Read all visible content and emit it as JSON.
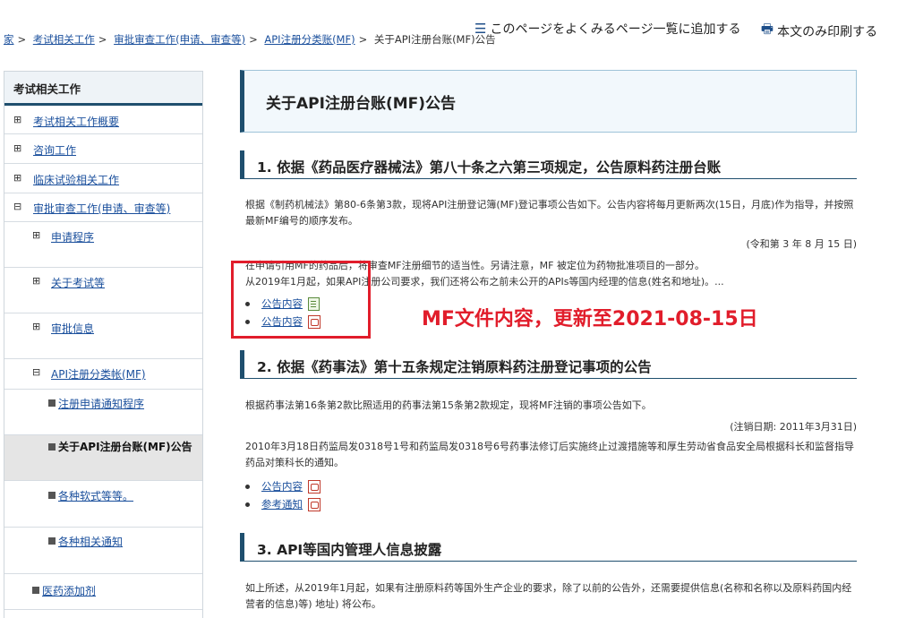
{
  "utility": {
    "favorites_label": "このページをよくみるページ一覧に追加する",
    "print_label": "本文のみ印刷する"
  },
  "breadcrumb": [
    {
      "label": "家"
    },
    {
      "label": "考试相关工作"
    },
    {
      "label": "审批审查工作(申请、审查等)"
    },
    {
      "label": "API注册分类账(MF)"
    },
    {
      "label": "关于API注册台账(MF)公告"
    }
  ],
  "sidebar": {
    "title": "考试相关工作",
    "items": [
      {
        "label": "考试相关工作概要",
        "mark": "⊞"
      },
      {
        "label": "咨询工作",
        "mark": "⊞"
      },
      {
        "label": "临床试验相关工作",
        "mark": "⊞"
      },
      {
        "label": "审批审查工作(申请、审查等)",
        "mark": "⊟"
      },
      {
        "label": "申请程序",
        "mark": "⊞"
      },
      {
        "label": "关于考试等",
        "mark": "⊞"
      },
      {
        "label": "审批信息",
        "mark": "⊞"
      },
      {
        "label": "API注册分类帐(MF)",
        "mark": "⊟"
      },
      {
        "label": "注册申请通知程序"
      },
      {
        "label": "关于API注册台账(MF)公告"
      },
      {
        "label": "各种软式等等。"
      },
      {
        "label": "各种相关通知"
      },
      {
        "label": "医药添加剂"
      }
    ]
  },
  "main": {
    "title": "关于API注册台账(MF)公告",
    "section1": {
      "heading": "1. 依据《药品医疗器械法》第八十条之六第三项规定，公告原料药注册台账",
      "para1": "根据《制药机械法》第80-6条第3款，现将API注册登记簿(MF)登记事项公告如下。公告内容将每月更新两次(15日，月底)作为指导，并按照最新MF编号的顺序发布。",
      "date": "(令和第 3 年 8 月 15 日)",
      "para2": "在申请引用MF的药品后，将审查MF注册细节的适当性。另请注意，MF 被定位为药物批准项目的一部分。",
      "para3": "从2019年1月起，如果API注册公司要求，我们还将公布之前未公开的APIs等国内经理的信息(姓名和地址)。...",
      "links": [
        "公告内容",
        "公告内容"
      ]
    },
    "section2": {
      "heading": "2. 依据《药事法》第十五条规定注销原料药注册登记事项的公告",
      "para1": "根据药事法第16条第2款比照适用的药事法第15条第2款规定，现将MF注销的事项公告如下。",
      "date": "(注销日期: 2011年3月31日)",
      "para2": "2010年3月18日药监局发0318号1号和药监局发0318号6号药事法修订后实施终止过渡措施等和厚生劳动省食品安全局根据科长和监督指导药品对策科长的通知。",
      "links": [
        "公告内容",
        "参考通知"
      ]
    },
    "section3": {
      "heading": "3. API等国内管理人信息披露",
      "para1": "如上所述，从2019年1月起，如果有注册原料药等国外生产企业的要求，除了以前的公告外，还需要提供信息(名称和名称以及原料药国内经营者的信息)等) 地址) 将公布。"
    }
  },
  "annotation": {
    "text": "MF文件内容，更新至2021-08-15日",
    "color": "#e11d2b"
  }
}
